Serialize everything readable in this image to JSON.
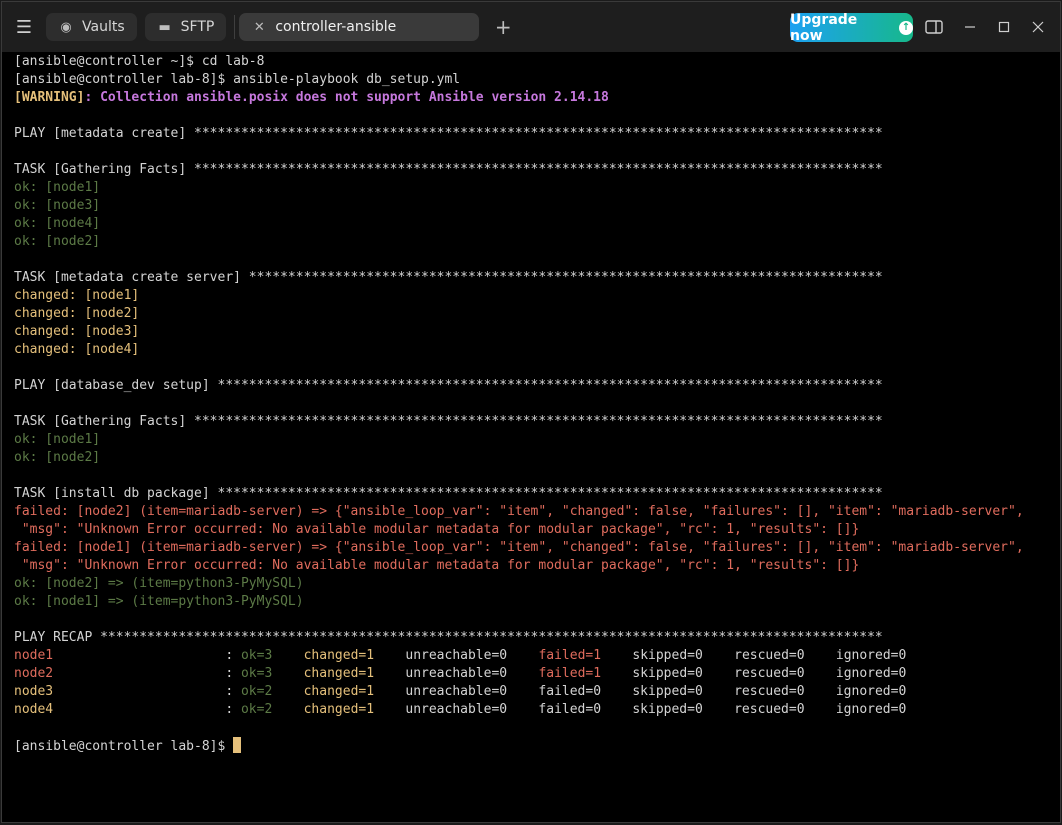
{
  "titlebar": {
    "tabs": [
      {
        "label": "Vaults",
        "icon": "vault-icon"
      },
      {
        "label": "SFTP",
        "icon": "folder-icon"
      },
      {
        "label": "controller-ansible",
        "icon": "close-icon"
      }
    ],
    "upgrade_label": "Upgrade now"
  },
  "terminal": {
    "lines": [
      [
        {
          "t": "[ansible@controller ~]$ cd lab-8",
          "c": ""
        }
      ],
      [
        {
          "t": "[ansible@controller lab-8]$ ansible-playbook db_setup.yml",
          "c": ""
        }
      ],
      [
        {
          "t": "[WARNING]",
          "c": "warn-tag"
        },
        {
          "t": ": Collection ansible.posix does not support Ansible version 2.14.18",
          "c": "warn"
        }
      ],
      [],
      [
        {
          "t": "PLAY [metadata create] ****************************************************************************************",
          "c": ""
        }
      ],
      [],
      [
        {
          "t": "TASK [Gathering Facts] ****************************************************************************************",
          "c": ""
        }
      ],
      [
        {
          "t": "ok: [node1]",
          "c": "ok"
        }
      ],
      [
        {
          "t": "ok: [node3]",
          "c": "ok"
        }
      ],
      [
        {
          "t": "ok: [node4]",
          "c": "ok"
        }
      ],
      [
        {
          "t": "ok: [node2]",
          "c": "ok"
        }
      ],
      [],
      [
        {
          "t": "TASK [metadata create server] *********************************************************************************",
          "c": ""
        }
      ],
      [
        {
          "t": "changed: [node1]",
          "c": "changed"
        }
      ],
      [
        {
          "t": "changed: [node2]",
          "c": "changed"
        }
      ],
      [
        {
          "t": "changed: [node3]",
          "c": "changed"
        }
      ],
      [
        {
          "t": "changed: [node4]",
          "c": "changed"
        }
      ],
      [],
      [
        {
          "t": "PLAY [database_dev setup] *************************************************************************************",
          "c": ""
        }
      ],
      [],
      [
        {
          "t": "TASK [Gathering Facts] ****************************************************************************************",
          "c": ""
        }
      ],
      [
        {
          "t": "ok: [node1]",
          "c": "ok"
        }
      ],
      [
        {
          "t": "ok: [node2]",
          "c": "ok"
        }
      ],
      [],
      [
        {
          "t": "TASK [install db package] *************************************************************************************",
          "c": ""
        }
      ],
      [
        {
          "t": "failed: [node2] (item=mariadb-server) => {\"ansible_loop_var\": \"item\", \"changed\": false, \"failures\": [], \"item\": \"mariadb-server\",",
          "c": "failed"
        }
      ],
      [
        {
          "t": " \"msg\": \"Unknown Error occurred: No available modular metadata for modular package\", \"rc\": 1, \"results\": []}",
          "c": "failed"
        }
      ],
      [
        {
          "t": "failed: [node1] (item=mariadb-server) => {\"ansible_loop_var\": \"item\", \"changed\": false, \"failures\": [], \"item\": \"mariadb-server\",",
          "c": "failed"
        }
      ],
      [
        {
          "t": " \"msg\": \"Unknown Error occurred: No available modular metadata for modular package\", \"rc\": 1, \"results\": []}",
          "c": "failed"
        }
      ],
      [
        {
          "t": "ok: [node2] => (item=python3-PyMySQL)",
          "c": "ok"
        }
      ],
      [
        {
          "t": "ok: [node1] => (item=python3-PyMySQL)",
          "c": "ok"
        }
      ],
      [],
      [
        {
          "t": "PLAY RECAP ****************************************************************************************************",
          "c": ""
        }
      ],
      [
        {
          "t": "node1",
          "c": "failed"
        },
        {
          "t": "                      : ",
          "c": ""
        },
        {
          "t": "ok=3",
          "c": "ok"
        },
        {
          "t": "    ",
          "c": ""
        },
        {
          "t": "changed=1",
          "c": "changed"
        },
        {
          "t": "    unreachable=0    ",
          "c": ""
        },
        {
          "t": "failed=1",
          "c": "failed"
        },
        {
          "t": "    skipped=0    rescued=0    ignored=0",
          "c": ""
        }
      ],
      [
        {
          "t": "node2",
          "c": "failed"
        },
        {
          "t": "                      : ",
          "c": ""
        },
        {
          "t": "ok=3",
          "c": "ok"
        },
        {
          "t": "    ",
          "c": ""
        },
        {
          "t": "changed=1",
          "c": "changed"
        },
        {
          "t": "    unreachable=0    ",
          "c": ""
        },
        {
          "t": "failed=1",
          "c": "failed"
        },
        {
          "t": "    skipped=0    rescued=0    ignored=0",
          "c": ""
        }
      ],
      [
        {
          "t": "node3",
          "c": "changed"
        },
        {
          "t": "                      : ",
          "c": ""
        },
        {
          "t": "ok=2",
          "c": "ok"
        },
        {
          "t": "    ",
          "c": ""
        },
        {
          "t": "changed=1",
          "c": "changed"
        },
        {
          "t": "    unreachable=0    failed=0    skipped=0    rescued=0    ignored=0",
          "c": ""
        }
      ],
      [
        {
          "t": "node4",
          "c": "changed"
        },
        {
          "t": "                      : ",
          "c": ""
        },
        {
          "t": "ok=2",
          "c": "ok"
        },
        {
          "t": "    ",
          "c": ""
        },
        {
          "t": "changed=1",
          "c": "changed"
        },
        {
          "t": "    unreachable=0    failed=0    skipped=0    rescued=0    ignored=0",
          "c": ""
        }
      ],
      [],
      [
        {
          "t": "[ansible@controller lab-8]$",
          "c": ""
        }
      ]
    ]
  },
  "colors": {
    "ok": "#5c7a46",
    "changed": "#e5c07b",
    "failed": "#e06c5d",
    "warning": "#c678dd",
    "upgrade_from": "#1da1f2",
    "upgrade_to": "#17b88a"
  }
}
